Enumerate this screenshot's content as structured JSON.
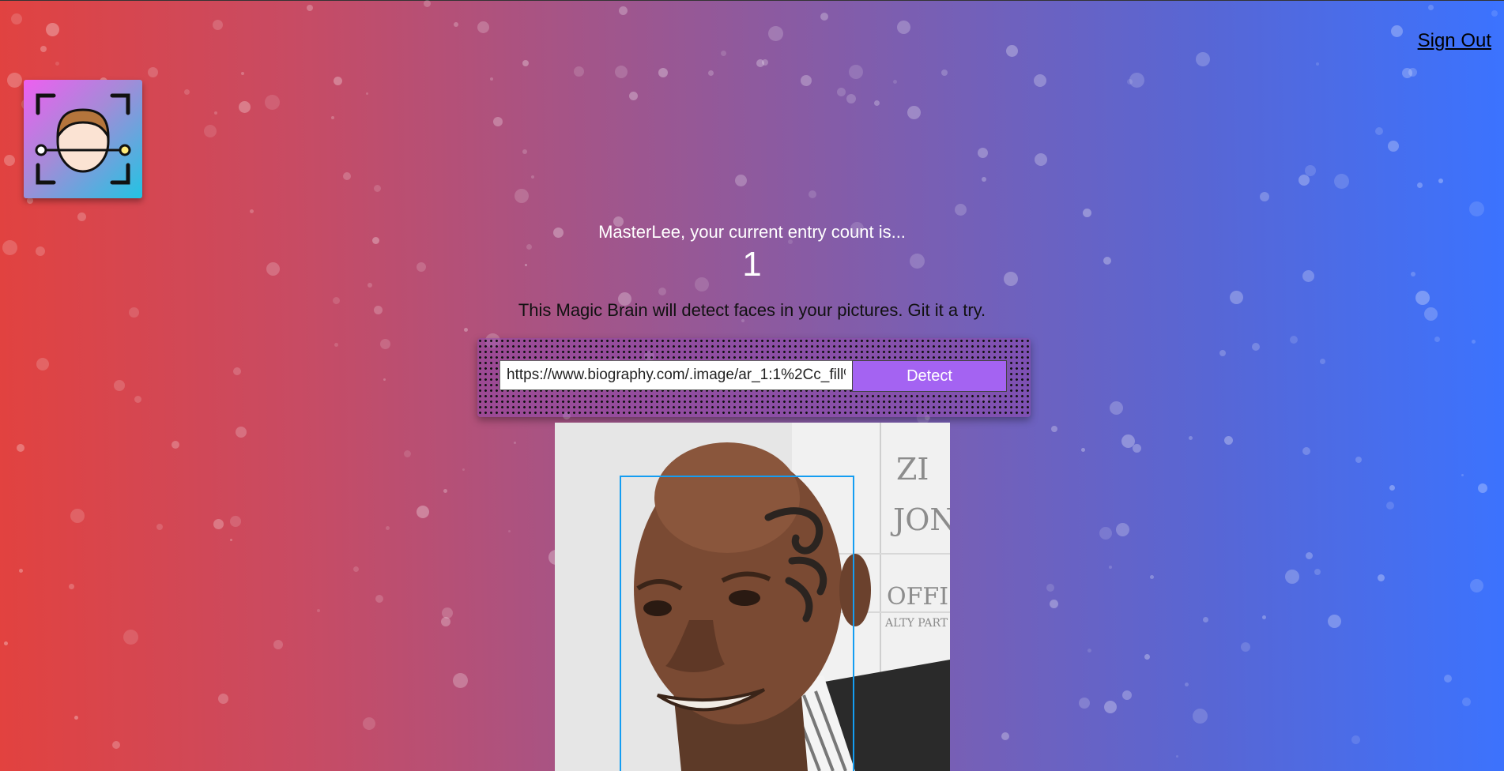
{
  "header": {
    "sign_out_label": "Sign Out"
  },
  "logo": {
    "icon": "face-recognition-icon"
  },
  "rank": {
    "greeting": "MasterLee, your current entry count is...",
    "count": "1"
  },
  "main": {
    "tagline": "This Magic Brain will detect faces in your pictures. Git it a try."
  },
  "form": {
    "url_value": "https://www.biography.com/.image/ar_1:1%2Cc_fill%",
    "detect_label": "Detect"
  },
  "photo": {
    "background_sign_lines": [
      "ZI",
      "JON",
      "OFFI",
      "ALTY PART"
    ]
  },
  "colors": {
    "gradient_left": "#e2423f",
    "gradient_right": "#3b73ff",
    "button": "#a463f2",
    "face_box": "#149df2"
  }
}
